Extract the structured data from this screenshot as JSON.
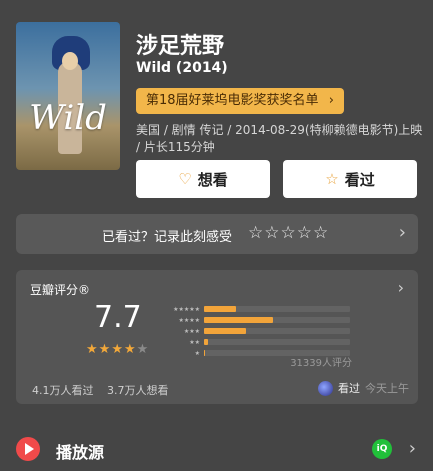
{
  "movie": {
    "title": "涉足荒野",
    "original_title": "Wild (2014)",
    "poster_text": "Wild",
    "award": "第18届好莱坞电影奖获奖名单",
    "meta": "美国 / 剧情 传记 / 2014-08-29(特柳赖德电影节)上映 / 片长115分钟"
  },
  "actions": {
    "want": "想看",
    "seen": "看过"
  },
  "rate_prompt": {
    "label": "已看过？记录此刻感受",
    "stars": "☆☆☆☆☆"
  },
  "rating": {
    "heading": "豆瓣评分®",
    "score": "7.7",
    "stars_filled": 4,
    "stars_total": 5,
    "rows": [
      {
        "label": "★★★★★",
        "percent": 22
      },
      {
        "label": "★★★★",
        "percent": 47
      },
      {
        "label": "★★★",
        "percent": 29
      },
      {
        "label": "★★",
        "percent": 3
      },
      {
        "label": "★",
        "percent": 1
      }
    ],
    "count": "31339人评分",
    "seen_count": "4.1万人看过",
    "want_count": "3.7万人想看",
    "friend_action": "看过",
    "friend_time": "今天上午"
  },
  "source": {
    "label": "播放源",
    "provider_badge": "iQ"
  },
  "colors": {
    "background": "#454545",
    "accent": "#f2a43a",
    "award_bg": "#f2b64a"
  }
}
